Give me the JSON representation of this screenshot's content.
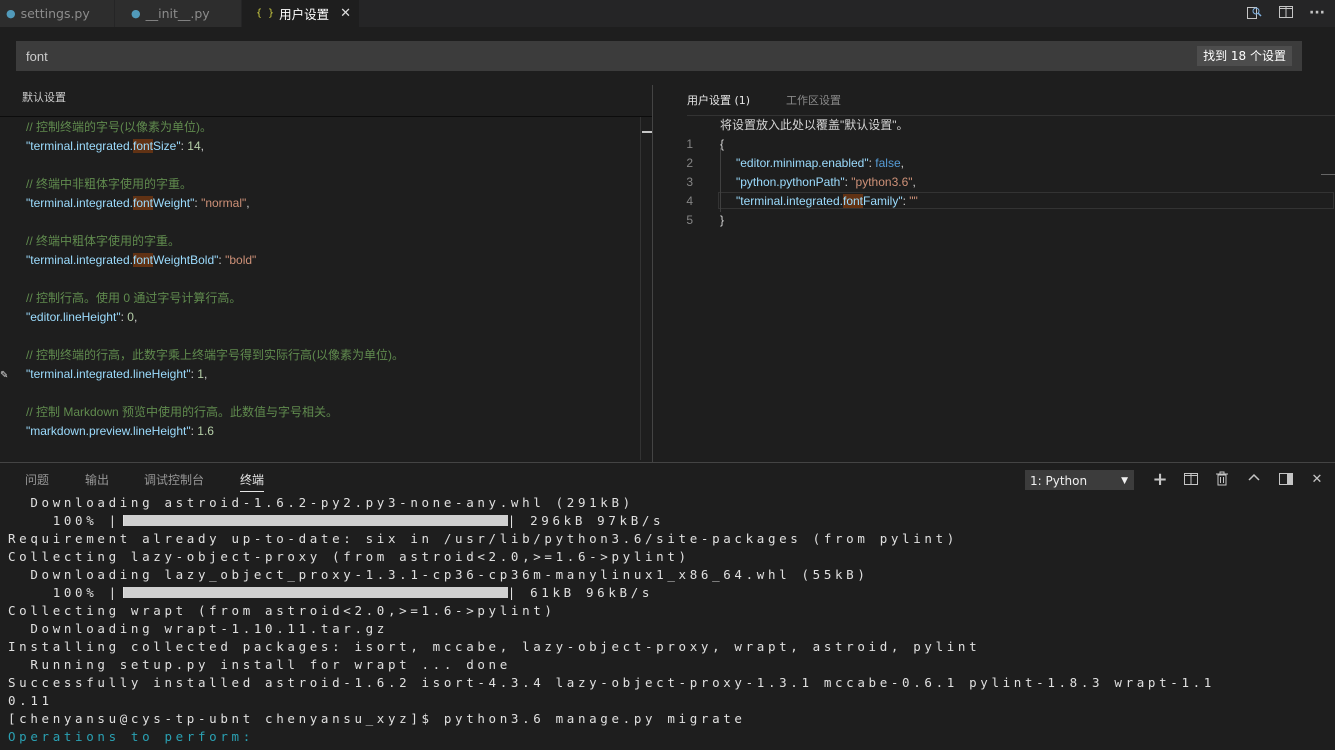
{
  "tabs": [
    {
      "label": "settings.py",
      "icon": "python-icon"
    },
    {
      "label": "__init__.py",
      "icon": "python-icon"
    },
    {
      "label": "用户设置",
      "icon": "json-braces-icon"
    }
  ],
  "tab_close": "✕",
  "search": {
    "value": "font",
    "count": "找到 18 个设置"
  },
  "left_pane": {
    "title": "默认设置",
    "entries": [
      {
        "comment": "// 控制终端的字号(以像素为单位)。",
        "key_pre": "\"terminal.integrated.",
        "key_hl": "font",
        "key_post": "Size\"",
        "sep": ": ",
        "value": "14",
        "value_type": "num",
        "tail": ","
      },
      {
        "comment": "// 终端中非粗体字使用的字重。",
        "key_pre": "\"terminal.integrated.",
        "key_hl": "font",
        "key_post": "Weight\"",
        "sep": ": ",
        "value": "\"normal\"",
        "value_type": "str",
        "tail": ","
      },
      {
        "comment": "// 终端中粗体字使用的字重。",
        "key_pre": "\"terminal.integrated.",
        "key_hl": "font",
        "key_post": "WeightBold\"",
        "sep": ": ",
        "value": "\"bold\"",
        "value_type": "str",
        "tail": ""
      },
      {
        "comment": "// 控制行高。使用 0 通过字号计算行高。",
        "key_pre": "\"editor.lineHeight\"",
        "key_hl": "",
        "key_post": "",
        "sep": ": ",
        "value": "0",
        "value_type": "num",
        "tail": ","
      },
      {
        "comment": "// 控制终端的行高，此数字乘上终端字号得到实际行高(以像素为单位)。",
        "key_pre": "\"terminal.integrated.lineHeight\"",
        "key_hl": "",
        "key_post": "",
        "sep": ": ",
        "value": "1",
        "value_type": "num",
        "tail": ","
      },
      {
        "comment": "// 控制 Markdown 预览中使用的行高。此数值与字号相关。",
        "key_pre": "\"markdown.preview.lineHeight\"",
        "key_hl": "",
        "key_post": "",
        "sep": ": ",
        "value": "1.6",
        "value_type": "num",
        "tail": ""
      }
    ]
  },
  "right_pane": {
    "tab_user": "用户设置 (1)",
    "tab_workspace": "工作区设置",
    "hint": "将设置放入此处以覆盖\"默认设置\"。",
    "line_numbers": [
      "1",
      "2",
      "3",
      "4",
      "5"
    ],
    "open_brace": "{",
    "close_brace": "}",
    "lines": [
      {
        "key": "\"editor.minimap.enabled\"",
        "sep": ": ",
        "value": "false",
        "tail": ","
      },
      {
        "key": "\"python.pythonPath\"",
        "sep": ": ",
        "value": "\"python3.6\"",
        "tail": ","
      },
      {
        "key_pre": "\"terminal.integrated.",
        "key_hl": "font",
        "key_post": "Family\"",
        "sep": ": ",
        "value": "\"\""
      }
    ]
  },
  "panel": {
    "tabs": [
      "问题",
      "输出",
      "调试控制台",
      "终端"
    ],
    "active_tab": "终端",
    "terminal_select": "1: Python",
    "terminal_lines": [
      "  Downloading astroid-1.6.2-py2.py3-none-any.whl (291kB)",
      "    100% |",
      "Requirement already up-to-date: six in /usr/lib/python3.6/site-packages (from pylint)",
      "Collecting lazy-object-proxy (from astroid<2.0,>=1.6->pylint)",
      "  Downloading lazy_object_proxy-1.3.1-cp36-cp36m-manylinux1_x86_64.whl (55kB)",
      "    100% |",
      "Collecting wrapt (from astroid<2.0,>=1.6->pylint)",
      "  Downloading wrapt-1.10.11.tar.gz",
      "Installing collected packages: isort, mccabe, lazy-object-proxy, wrapt, astroid, pylint",
      "  Running setup.py install for wrapt ... done",
      "Successfully installed astroid-1.6.2 isort-4.3.4 lazy-object-proxy-1.3.1 mccabe-0.6.1 pylint-1.8.3 wrapt-1.1",
      "0.11",
      "[chenyansu@cys-tp-ubnt chenyansu_xyz]$ python3.6 manage.py migrate",
      "Operations to perform:"
    ],
    "progress": [
      {
        "percent": 100,
        "suffix": "| 296kB 97kB/s"
      },
      {
        "percent": 100,
        "suffix": "| 61kB 96kB/s"
      }
    ]
  }
}
